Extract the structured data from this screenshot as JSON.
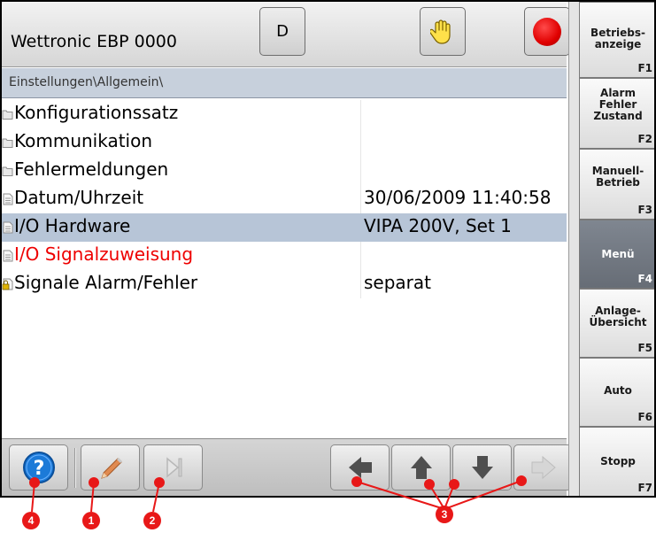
{
  "header": {
    "title": "Wettronic EBP 0000",
    "d_button_label": "D"
  },
  "breadcrumb": "Einstellungen\\Allgemein\\",
  "list": {
    "rows": [
      {
        "name": "Konfigurationssatz",
        "value": "",
        "icon": "folder-icon"
      },
      {
        "name": "Kommunikation",
        "value": "",
        "icon": "folder-icon"
      },
      {
        "name": "Fehlermeldungen",
        "value": "",
        "icon": "folder-icon"
      },
      {
        "name": "Datum/Uhrzeit",
        "value": "30/06/2009 11:40:58",
        "icon": "document-icon"
      },
      {
        "name": "I/O Hardware",
        "value": "VIPA 200V, Set 1",
        "icon": "document-icon",
        "selected": true
      },
      {
        "name": "I/O Signalzuweisung",
        "value": "",
        "icon": "document-icon",
        "error": true
      },
      {
        "name": "Signale Alarm/Fehler",
        "value": "separat",
        "icon": "locked-document-icon"
      }
    ]
  },
  "fkeys": [
    {
      "label": "Betriebs-\nanzeige",
      "code": "F1"
    },
    {
      "label": "Alarm\nFehler\nZustand",
      "code": "F2"
    },
    {
      "label": "Manuell-\nBetrieb",
      "code": "F3"
    },
    {
      "label": "Menü",
      "code": "F4",
      "active": true
    },
    {
      "label": "Anlage-\nÜbersicht",
      "code": "F5"
    },
    {
      "label": "Auto",
      "code": "F6"
    },
    {
      "label": "Stopp",
      "code": "F7"
    }
  ],
  "toolbar": {
    "buttons": [
      "help-icon",
      "pencil-icon",
      "skip-end-icon",
      "arrow-left-icon",
      "arrow-up-icon",
      "arrow-down-icon",
      "arrow-right-icon"
    ]
  },
  "callouts": [
    "4",
    "1",
    "2",
    "3"
  ],
  "colors": {
    "selected_row": "#b7c5d7",
    "error_text": "#ee0000",
    "active_fkey": "#737a84",
    "callout": "#e81818"
  }
}
